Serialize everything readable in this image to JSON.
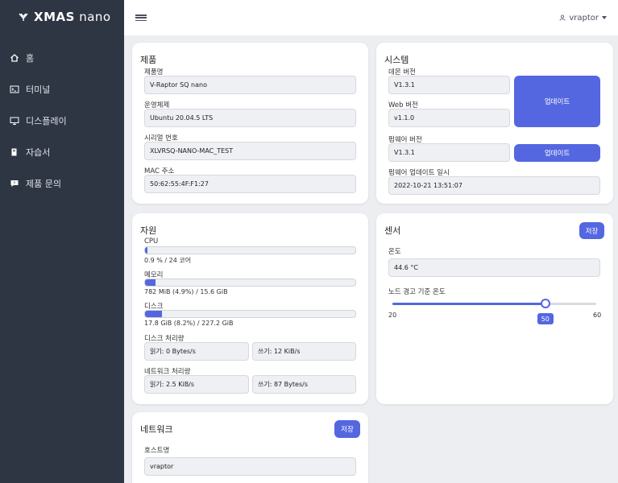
{
  "app": {
    "brand_prefix": "XMAS",
    "brand_suffix": "nano"
  },
  "sidebar": {
    "items": [
      {
        "label": "홈",
        "icon": "home-icon"
      },
      {
        "label": "터미널",
        "icon": "terminal-icon"
      },
      {
        "label": "디스플레이",
        "icon": "display-icon"
      },
      {
        "label": "자습서",
        "icon": "book-icon"
      },
      {
        "label": "제품 문의",
        "icon": "chat-icon"
      }
    ]
  },
  "topbar": {
    "user": "vraptor"
  },
  "product": {
    "title": "제품",
    "name_label": "제품명",
    "name_value": "V-Raptor SQ nano",
    "os_label": "운영체제",
    "os_value": "Ubuntu 20.04.5 LTS",
    "serial_label": "시리얼 번호",
    "serial_value": "XLVRSQ-NANO-MAC_TEST",
    "mac_label": "MAC 주소",
    "mac_value": "50:62:55:4F:F1:27"
  },
  "system": {
    "title": "시스템",
    "daemon_label": "데몬 버전",
    "daemon_value": "V1.3.1",
    "web_label": "Web 버전",
    "web_value": "v1.1.0",
    "firmware_label": "펌웨어 버전",
    "firmware_value": "V1.3.1",
    "fw_update_label": "펌웨어 업데이트 일시",
    "fw_update_value": "2022-10-21 13:51:07",
    "update_button_1": "업데이트",
    "update_button_2": "업데이트"
  },
  "resources": {
    "title": "자원",
    "cpu_label": "CPU",
    "cpu_text": "0.9 % / 24 코어",
    "cpu_fraction": 0.009,
    "mem_label": "메모리",
    "mem_text": "782 MiB (4.9%) / 15.6 GiB",
    "mem_fraction": 0.049,
    "disk_label": "디스크",
    "disk_text": "17.8 GiB (8.2%) / 227.2 GiB",
    "disk_fraction": 0.082,
    "disk_io_label": "디스크 처리량",
    "disk_read": "읽기: 0 Bytes/s",
    "disk_write": "쓰기: 12 KiB/s",
    "net_io_label": "네트워크 처리량",
    "net_read": "읽기: 2.5 KiB/s",
    "net_write": "쓰기: 87 Bytes/s"
  },
  "sensor": {
    "title": "센서",
    "save_button": "저장",
    "temp_label": "온도",
    "temp_value": "44.6 °C",
    "threshold_label": "노드 경고 기준 온도",
    "slider_min": "20",
    "slider_max": "60",
    "slider_value": "50",
    "slider_fraction": 0.75
  },
  "network": {
    "title": "네트워크",
    "save_button": "저장",
    "hostname_label": "호스트명",
    "hostname_value": "vraptor"
  }
}
